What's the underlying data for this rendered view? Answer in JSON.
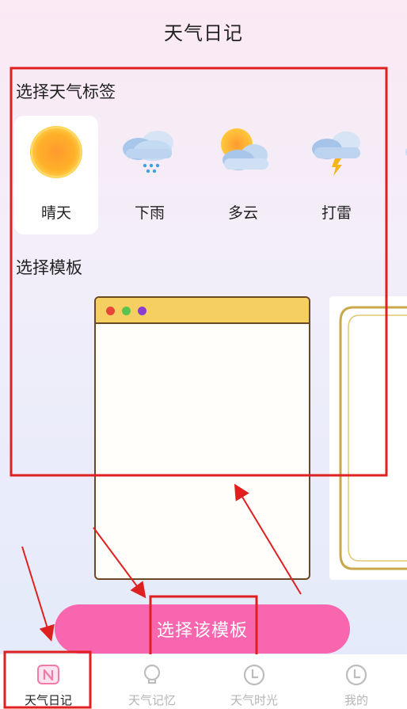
{
  "header": {
    "title": "天气日记"
  },
  "weather_section": {
    "title": "选择天气标签"
  },
  "weather_tags": [
    {
      "label": "晴天",
      "icon": "sun-icon",
      "selected": true
    },
    {
      "label": "下雨",
      "icon": "rain-cloud-icon",
      "selected": false
    },
    {
      "label": "多云",
      "icon": "partly-cloudy-icon",
      "selected": false
    },
    {
      "label": "打雷",
      "icon": "thunder-cloud-icon",
      "selected": false
    }
  ],
  "template_section": {
    "title": "选择模板"
  },
  "templates": [
    {
      "name": "window-template",
      "bar_color": "#f5cf62",
      "dot_colors": [
        "#e8463a",
        "#5ac34e",
        "#8a3fd1"
      ]
    },
    {
      "name": "gold-frame-template"
    }
  ],
  "actions": {
    "choose_template_label": "选择该模板"
  },
  "tab_bar": {
    "tabs": [
      {
        "label": "天气日记",
        "icon": "diary-n-icon",
        "active": true
      },
      {
        "label": "天气记忆",
        "icon": "lightbulb-icon",
        "active": false
      },
      {
        "label": "天气时光",
        "icon": "clock-icon",
        "active": false
      },
      {
        "label": "我的",
        "icon": "clock-icon",
        "active": false
      }
    ]
  },
  "colors": {
    "accent_pink": "#f866b0",
    "annotation_red": "#e02020",
    "template_border": "#6b4a22"
  }
}
